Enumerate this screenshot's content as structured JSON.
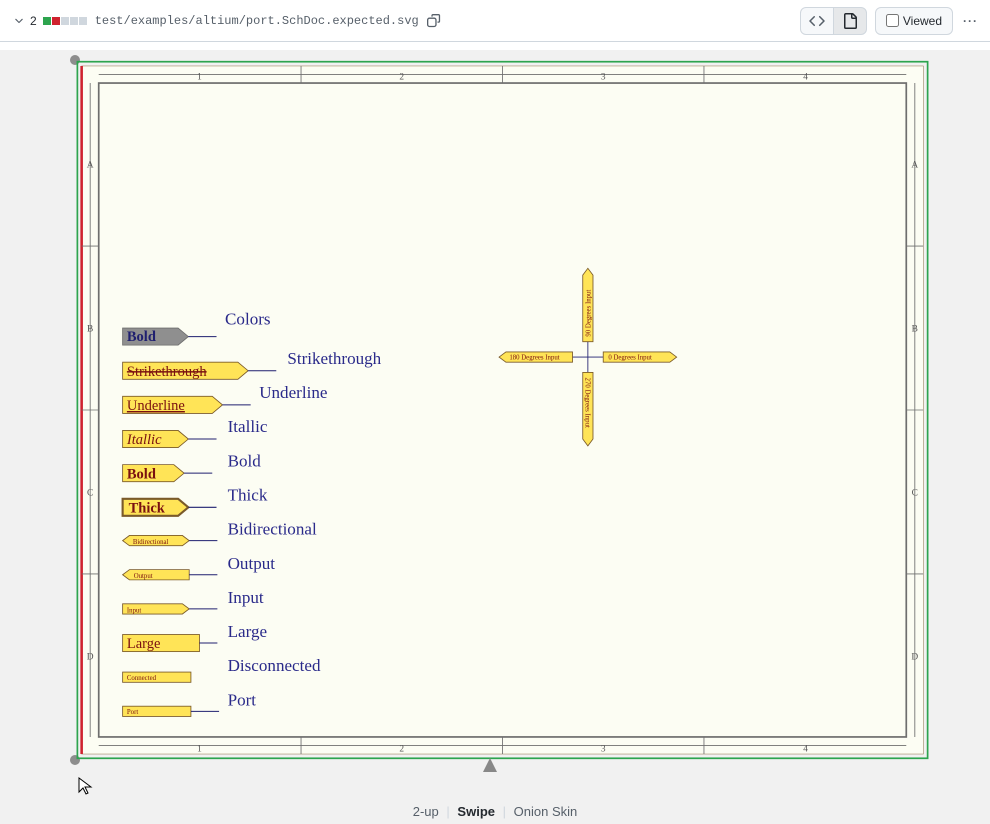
{
  "header": {
    "changed_count": "2",
    "filepath": "test/examples/altium/port.SchDoc.expected.svg",
    "viewed_label": "Viewed"
  },
  "modes": {
    "a": "2-up",
    "b": "Swipe",
    "c": "Onion Skin"
  },
  "sheet": {
    "cols": [
      "1",
      "2",
      "3",
      "4"
    ],
    "rows": [
      "A",
      "B",
      "C",
      "D"
    ]
  },
  "ports": {
    "colors": {
      "tag": "Bold",
      "label": "Colors"
    },
    "strike": {
      "tag": "Strikethrough",
      "label": "Strikethrough"
    },
    "under": {
      "tag": "Underline",
      "label": "Underline"
    },
    "ital": {
      "tag": "Itallic",
      "label": "Itallic"
    },
    "bold": {
      "tag": "Bold",
      "label": "Bold"
    },
    "thick": {
      "tag": "Thick",
      "label": "Thick"
    },
    "bidi": {
      "tag": "Bidirectional",
      "label": "Bidirectional"
    },
    "out": {
      "tag": "Output",
      "label": "Output"
    },
    "in": {
      "tag": "Input",
      "label": "Input"
    },
    "large": {
      "tag": "Large",
      "label": "Large"
    },
    "disc": {
      "tag": "Connected",
      "label": "Disconnected"
    },
    "port": {
      "tag": "Port",
      "label": "Port"
    },
    "r0": "0 Degrees Input",
    "r90": "90 Degrees Input",
    "r180": "180 Degrees Input",
    "r270": "270 Degrees Input"
  }
}
